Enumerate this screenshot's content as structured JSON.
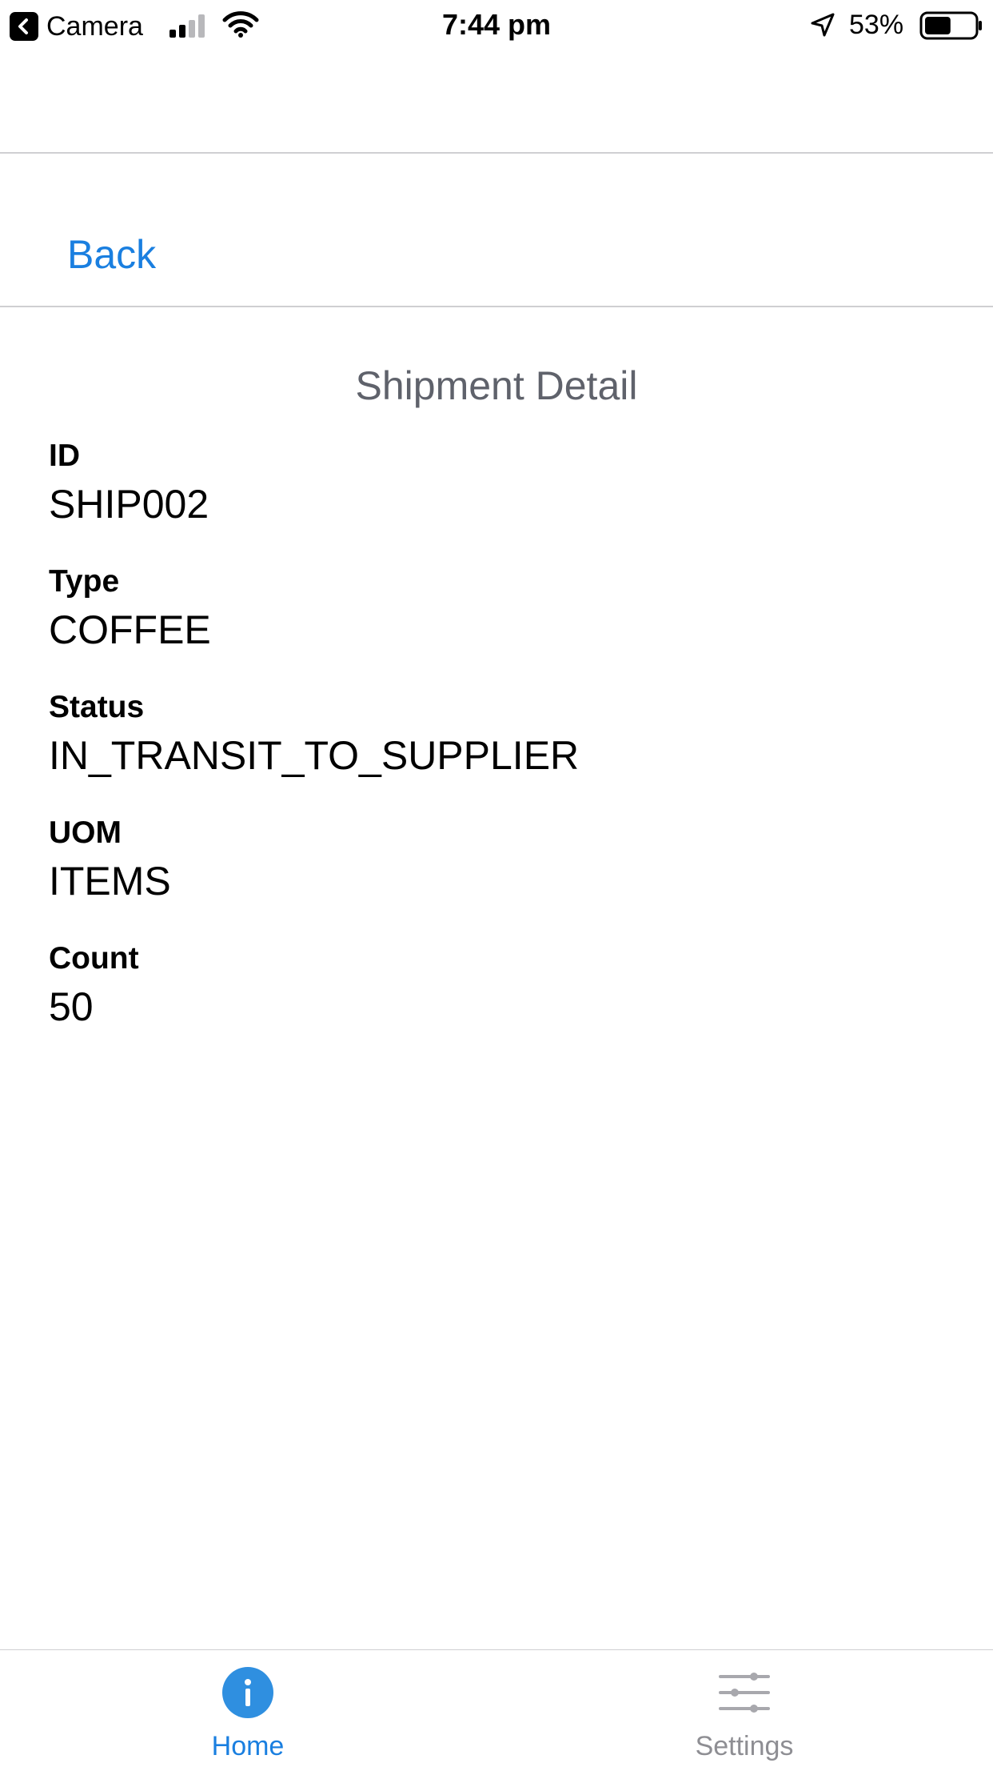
{
  "status_bar": {
    "back_app_label": "Camera",
    "time": "7:44 pm",
    "battery_percent": "53%",
    "battery_level": 0.53,
    "signal_bars_active": 2,
    "signal_bars_total": 4
  },
  "nav": {
    "back_label": "Back"
  },
  "page": {
    "title": "Shipment Detail"
  },
  "fields": [
    {
      "label": "ID",
      "value": "SHIP002"
    },
    {
      "label": "Type",
      "value": "COFFEE"
    },
    {
      "label": "Status",
      "value": "IN_TRANSIT_TO_SUPPLIER"
    },
    {
      "label": "UOM",
      "value": "ITEMS"
    },
    {
      "label": "Count",
      "value": "50"
    }
  ],
  "tabbar": {
    "tabs": [
      {
        "label": "Home",
        "icon": "info-icon",
        "active": true
      },
      {
        "label": "Settings",
        "icon": "sliders-icon",
        "active": false
      }
    ]
  },
  "colors": {
    "accent": "#1a7fe0",
    "title_gray": "#5f626b",
    "inactive_gray": "#8e8e93",
    "divider": "#cfcfd2"
  }
}
